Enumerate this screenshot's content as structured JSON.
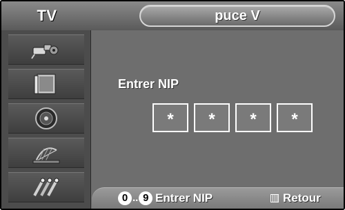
{
  "header": {
    "source": "TV",
    "title": "puce V"
  },
  "sidebar": {
    "items": [
      {
        "icon": "input-plug-icon"
      },
      {
        "icon": "picture-screen-icon"
      },
      {
        "icon": "sound-speaker-icon"
      },
      {
        "icon": "antenna-channel-icon"
      },
      {
        "icon": "setup-tools-icon"
      }
    ]
  },
  "main": {
    "prompt": "Entrer NIP",
    "pin": [
      "*",
      "*",
      "*",
      "*"
    ]
  },
  "footer": {
    "num_start": "0",
    "num_sep": "..",
    "num_end": "9",
    "hint_enter": "Entrer NIP",
    "hint_return": "Retour"
  }
}
